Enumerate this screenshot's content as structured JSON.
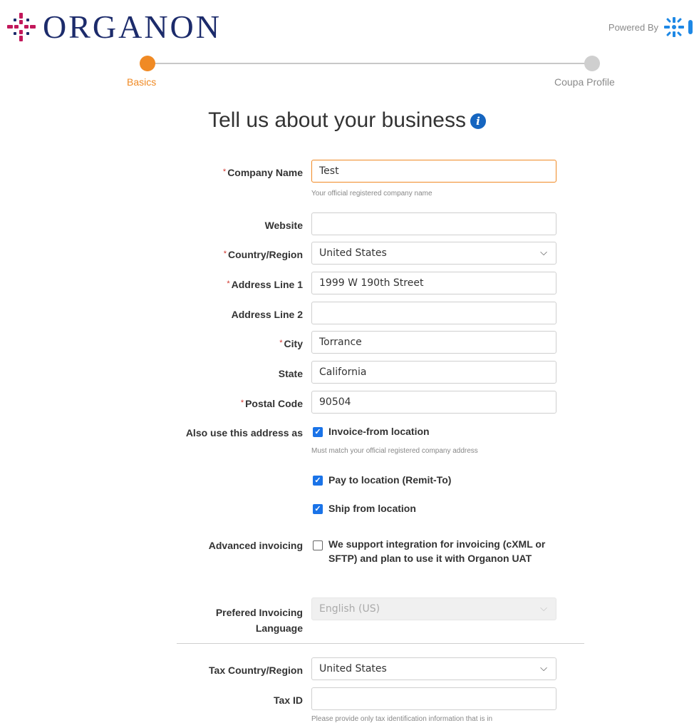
{
  "header": {
    "logo_text": "ORGANON",
    "powered_by": "Powered By"
  },
  "stepper": {
    "steps": [
      {
        "label": "Basics",
        "active": true
      },
      {
        "label": "Coupa Profile",
        "active": false
      }
    ]
  },
  "page": {
    "title": "Tell us about your business",
    "info_icon": "info-icon"
  },
  "form": {
    "company_name": {
      "label": "Company Name",
      "required": true,
      "value": "Test",
      "hint": "Your official registered company name"
    },
    "website": {
      "label": "Website",
      "value": ""
    },
    "country": {
      "label": "Country/Region",
      "required": true,
      "value": "United States"
    },
    "address1": {
      "label": "Address Line 1",
      "required": true,
      "value": "1999 W 190th Street"
    },
    "address2": {
      "label": "Address Line 2",
      "value": ""
    },
    "city": {
      "label": "City",
      "required": true,
      "value": "Torrance"
    },
    "state": {
      "label": "State",
      "value": "California"
    },
    "postal_code": {
      "label": "Postal Code",
      "required": true,
      "value": "90504"
    },
    "also_use": {
      "label": "Also use this address as",
      "options": [
        {
          "label": "Invoice-from location",
          "checked": true,
          "hint": "Must match your official registered company address"
        },
        {
          "label": "Pay to location (Remit-To)",
          "checked": true
        },
        {
          "label": "Ship from location",
          "checked": true
        }
      ]
    },
    "advanced_invoicing": {
      "label": "Advanced invoicing",
      "checked": false,
      "text": "We support integration for invoicing (cXML or SFTP) and plan to use it with Organon UAT"
    },
    "invoicing_language": {
      "label": "Prefered Invoicing Language",
      "value": "English (US)",
      "disabled": true
    },
    "tax_country": {
      "label": "Tax Country/Region",
      "value": "United States"
    },
    "tax_id": {
      "label": "Tax ID",
      "value": "",
      "hint": "Please provide only tax identification information that is in"
    }
  },
  "colors": {
    "accent": "#f08a24",
    "brand_navy": "#1c2b6b",
    "brand_magenta": "#c2185b",
    "checkbox_blue": "#1a73e8",
    "required_red": "#d0342c"
  }
}
